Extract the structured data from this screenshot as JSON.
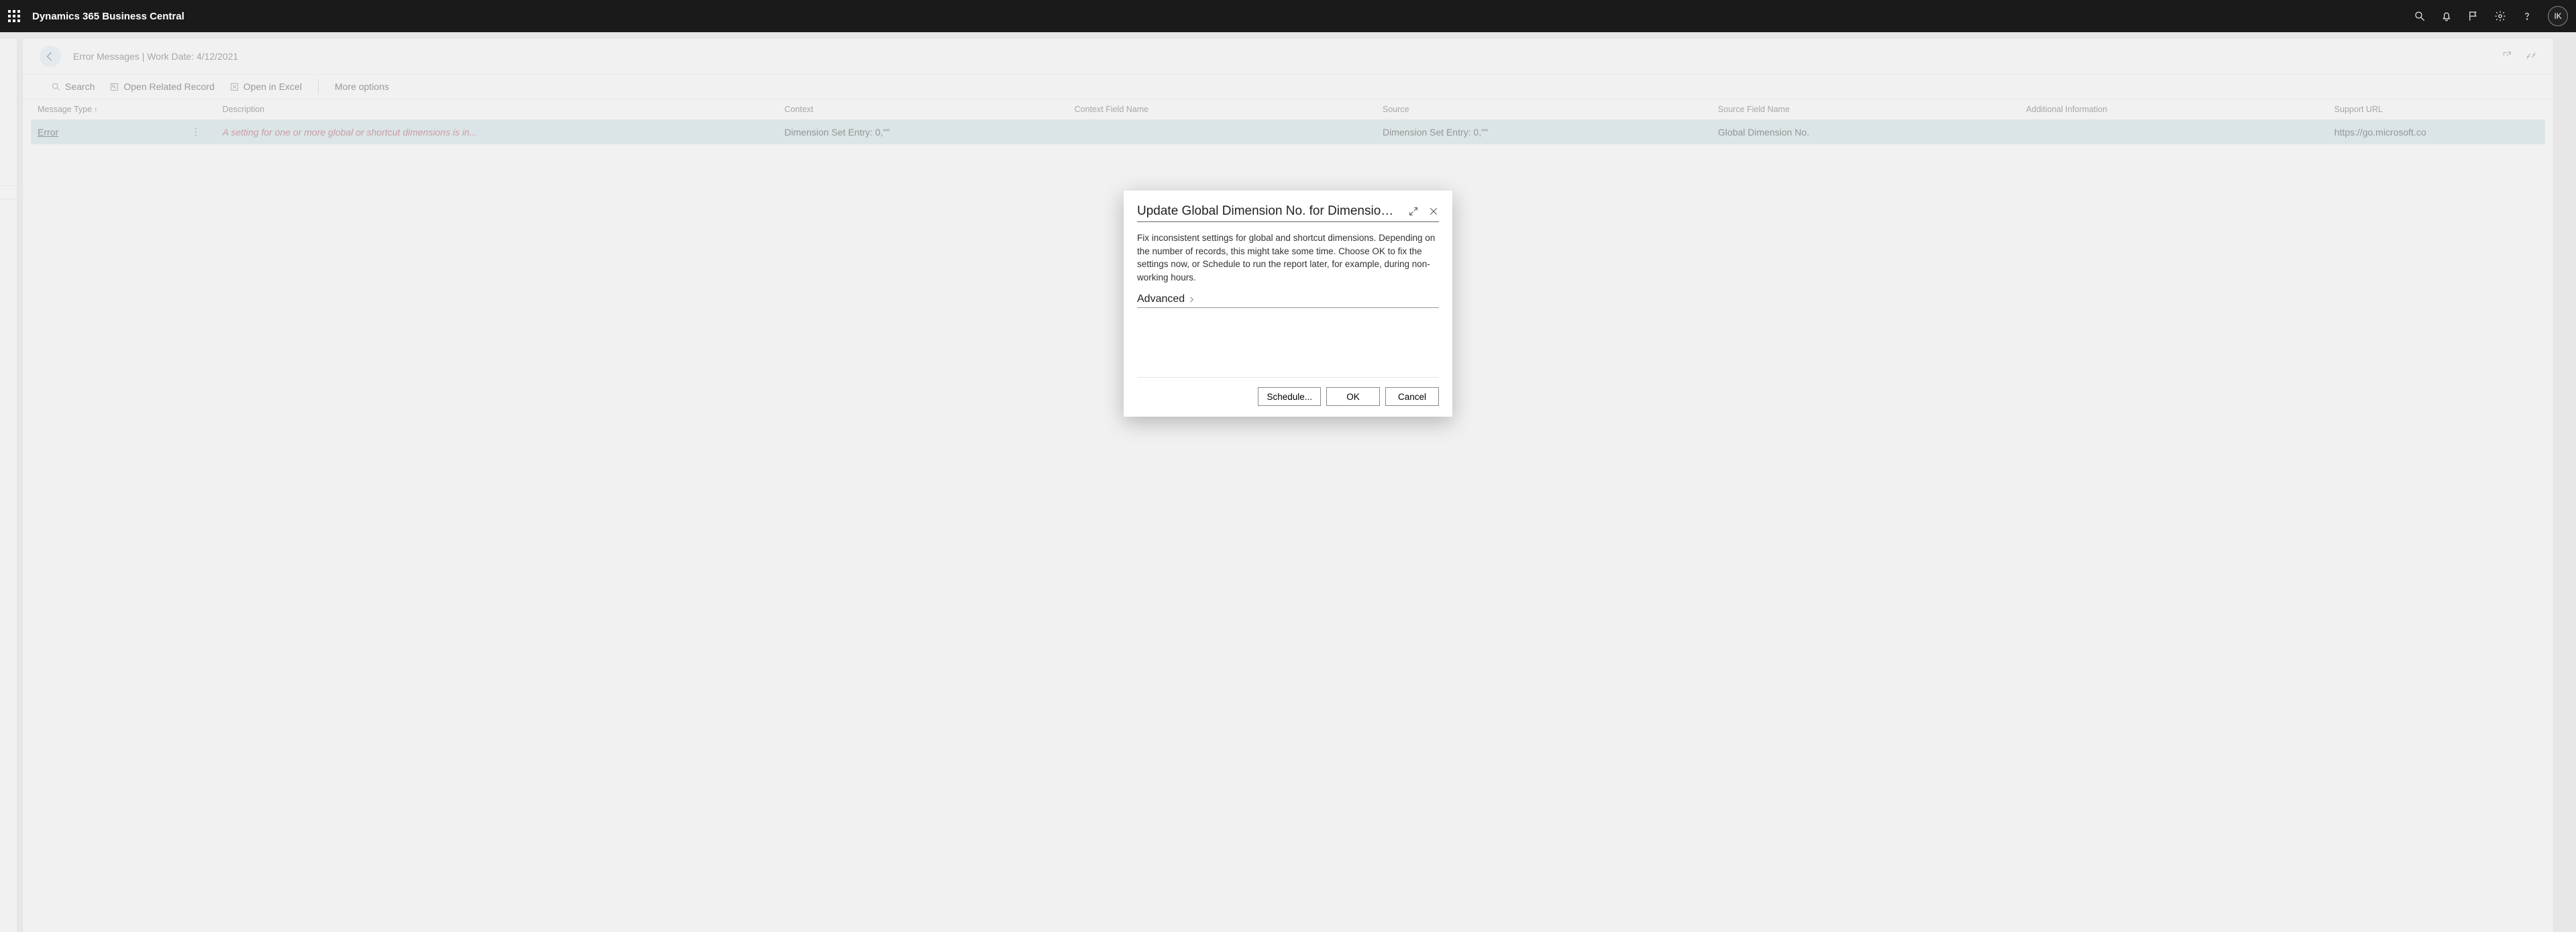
{
  "topbar": {
    "brand": "Dynamics 365 Business Central",
    "avatar_initials": "IK"
  },
  "page": {
    "title": "Error Messages | Work Date: 4/12/2021"
  },
  "actions": {
    "search": "Search",
    "open_related": "Open Related Record",
    "open_excel": "Open in Excel",
    "more_options": "More options"
  },
  "columns": {
    "message_type": "Message Type",
    "description": "Description",
    "context": "Context",
    "context_field_name": "Context Field Name",
    "source": "Source",
    "source_field_name": "Source Field Name",
    "additional_info": "Additional Information",
    "support_url": "Support URL"
  },
  "rows": [
    {
      "message_type": "Error",
      "description": "A setting for one or more global or shortcut dimensions is in...",
      "context": "Dimension Set Entry: 0,\"\"",
      "context_field_name": "",
      "source": "Dimension Set Entry: 0,\"\"",
      "source_field_name": "Global Dimension No.",
      "additional_info": "",
      "support_url": "https://go.microsoft.co"
    }
  ],
  "dialog": {
    "title": "Update Global Dimension No. for Dimension Set E...",
    "body": "Fix inconsistent settings for global and shortcut dimensions. Depending on the number of records, this might take some time. Choose OK to fix the settings now, or Schedule to run the report later, for example, during non-working hours.",
    "advanced_label": "Advanced",
    "buttons": {
      "schedule": "Schedule...",
      "ok": "OK",
      "cancel": "Cancel"
    }
  }
}
